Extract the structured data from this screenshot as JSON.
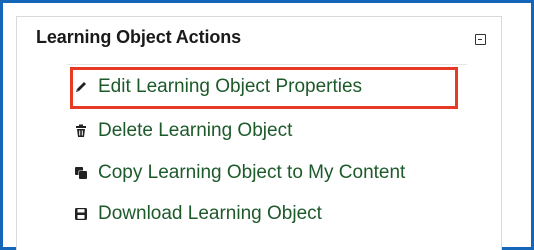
{
  "panel": {
    "title": "Learning Object Actions",
    "collapse_icon": "collapse-icon"
  },
  "actions": [
    {
      "label": "Edit Learning Object Properties",
      "icon": "pencil-icon"
    },
    {
      "label": "Delete Learning Object",
      "icon": "trash-icon"
    },
    {
      "label": "Copy Learning Object to My Content",
      "icon": "copy-icon"
    },
    {
      "label": "Download Learning Object",
      "icon": "floppy-disk-icon"
    }
  ],
  "colors": {
    "frame": "#1565b8",
    "highlight": "#e63a25",
    "action_text": "#1d5a2a"
  }
}
